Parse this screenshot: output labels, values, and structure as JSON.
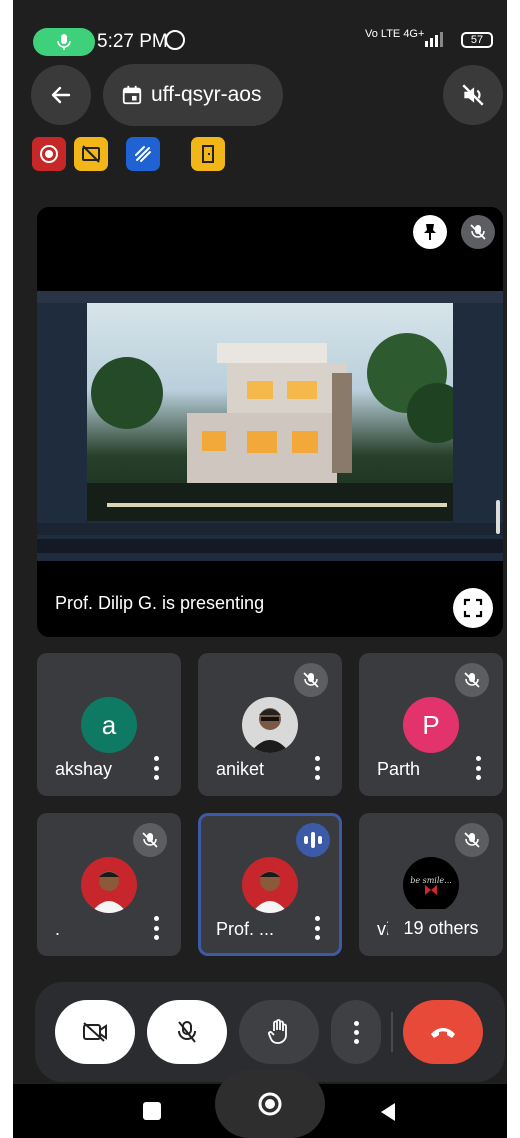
{
  "status_bar": {
    "time": "5:27 PM",
    "network_left": "Vo LTE 4G+",
    "network_right": "Vo LTE",
    "battery": "57"
  },
  "meeting": {
    "code": "uff-qsyr-aos"
  },
  "icons": {
    "back": "back-arrow-icon",
    "calendar": "calendar-icon",
    "speaker_muted": "speaker-off-icon",
    "record": "record-icon",
    "captions_off": "captions-off-icon",
    "whiteboard": "whiteboard-icon",
    "breakout": "breakout-room-icon",
    "pin": "pin-icon",
    "mic_off": "mic-off-icon",
    "fullscreen": "fullscreen-icon"
  },
  "presentation": {
    "presenter_label": "Prof. Dilip G. is presenting"
  },
  "participants": [
    {
      "name": "akshay",
      "initial": "a",
      "avatar_color": "#0f7a63",
      "muted": false
    },
    {
      "name": "aniket",
      "initial": "",
      "avatar_color": "#555555",
      "muted": true
    },
    {
      "name": "Parth",
      "initial": "P",
      "avatar_color": "#e2336d",
      "muted": true
    },
    {
      "name": ".",
      "initial": "",
      "avatar_color": "#c7262c",
      "muted": true
    },
    {
      "name": "Prof. ...",
      "initial": "",
      "avatar_color": "#c7262c",
      "muted": false,
      "speaking": true
    },
    {
      "name": "vid",
      "initial": "",
      "avatar_color": "#000000",
      "muted": true,
      "avatar_caption": "be smile..."
    }
  ],
  "others": {
    "label": "19 others"
  },
  "colors": {
    "mic_active": "#3ed07a",
    "end_call": "#e84a3a",
    "speaking_border": "#3d5aa8"
  }
}
